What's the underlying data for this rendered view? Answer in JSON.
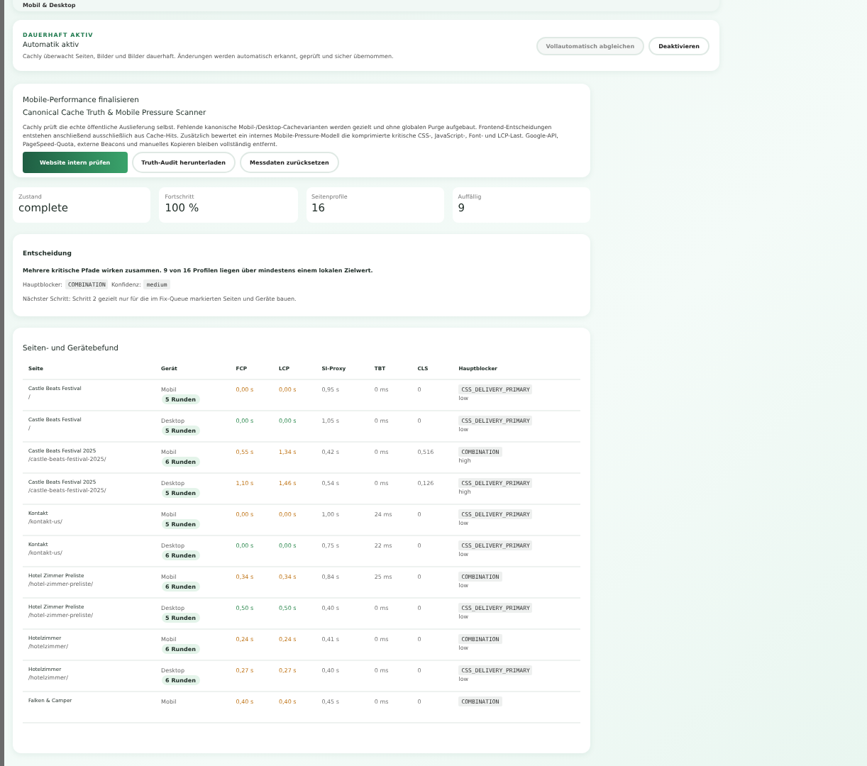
{
  "top_card": {
    "text": "Mobil & Desktop"
  },
  "automation": {
    "eyebrow": "DAUERHAFT AKTIV",
    "title": "Automatik aktiv",
    "description": "Cachly überwacht Seiten, Bilder und Bilder dauerhaft. Änderungen werden automatisch erkannt, geprüft und sicher übernommen.",
    "buttons": [
      {
        "label": "Vollautomatisch abgleichen",
        "disabled": true
      },
      {
        "label": "Deaktivieren",
        "disabled": false
      }
    ]
  },
  "mobile": {
    "heading": "Mobile-Performance finalisieren",
    "title": "Canonical Cache Truth & Mobile Pressure Scanner",
    "description": "Cachly prüft die echte öffentliche Auslieferung selbst. Fehlende kanonische Mobil-/Desktop-Cachevarianten werden gezielt und ohne globalen Purge aufgebaut. Frontend-Entscheidungen entstehen anschließend ausschließlich aus Cache-Hits. Zusätzlich bewertet ein internes Mobile-Pressure-Modell die komprimierte kritische CSS-, JavaScript-, Font- und LCP-Last. Google-API, PageSpeed-Quota, externe Beacons und manuelles Kopieren bleiben vollständig entfernt.",
    "buttons": [
      {
        "label": "Website intern prüfen",
        "kind": "primary"
      },
      {
        "label": "Truth-Audit herunterladen",
        "kind": "secondary"
      },
      {
        "label": "Messdaten zurücksetzen",
        "kind": "secondary"
      }
    ]
  },
  "stats": [
    {
      "label": "Zustand",
      "value": "complete"
    },
    {
      "label": "Fortschritt",
      "value": "100 %"
    },
    {
      "label": "Seitenprofile",
      "value": "16"
    },
    {
      "label": "Auffällig",
      "value": "9"
    }
  ],
  "decision": {
    "title": "Entscheidung",
    "summary": "Mehrere kritische Pfade wirken zusammen. 9 von 16 Profilen liegen über mindestens einem lokalen Zielwert.",
    "blocker_label": "Hauptblocker:",
    "blocker": "COMBINATION",
    "confidence_label": "Konfidenz:",
    "confidence": "medium",
    "next_step": "Nächster Schritt: Schritt 2 gezielt nur für die im Fix-Queue markierten Seiten und Geräte bauen."
  },
  "table": {
    "title": "Seiten- und Gerätebefund",
    "columns": [
      "Seite",
      "Gerät",
      "FCP",
      "LCP",
      "SI-Proxy",
      "TBT",
      "CLS",
      "Hauptblocker"
    ],
    "rows": [
      {
        "page": "Castle Beats Festival",
        "path": "/",
        "device": "Mobil",
        "rounds": "5 Runden",
        "fcp": {
          "text": "0,00 s",
          "slow": true
        },
        "lcp": {
          "text": "0,00 s",
          "slow": true
        },
        "si": "0,95 s",
        "tbt": "0 ms",
        "cls": "0",
        "blocker": "CSS_DELIVERY_PRIMARY",
        "impact": "low"
      },
      {
        "page": "Castle Beats Festival",
        "path": "/",
        "device": "Desktop",
        "rounds": "5 Runden",
        "fcp": {
          "text": "0,00 s",
          "slow": false
        },
        "lcp": {
          "text": "0,00 s",
          "slow": false
        },
        "si": "1,05 s",
        "tbt": "0 ms",
        "cls": "0",
        "blocker": "CSS_DELIVERY_PRIMARY",
        "impact": "low"
      },
      {
        "page": "Castle Beats Festival 2025",
        "path": "/castle-beats-festival-2025/",
        "device": "Mobil",
        "rounds": "6 Runden",
        "fcp": {
          "text": "0,55 s",
          "slow": true
        },
        "lcp": {
          "text": "1,34 s",
          "slow": true
        },
        "si": "0,42 s",
        "tbt": "0 ms",
        "cls": "0,516",
        "blocker": "COMBINATION",
        "impact": "high"
      },
      {
        "page": "Castle Beats Festival 2025",
        "path": "/castle-beats-festival-2025/",
        "device": "Desktop",
        "rounds": "5 Runden",
        "fcp": {
          "text": "1,10 s",
          "slow": true
        },
        "lcp": {
          "text": "1,46 s",
          "slow": true
        },
        "si": "0,54 s",
        "tbt": "0 ms",
        "cls": "0,126",
        "blocker": "CSS_DELIVERY_PRIMARY",
        "impact": "high"
      },
      {
        "page": "Kontakt",
        "path": "/kontakt-us/",
        "device": "Mobil",
        "rounds": "5 Runden",
        "fcp": {
          "text": "0,00 s",
          "slow": true
        },
        "lcp": {
          "text": "0,00 s",
          "slow": true
        },
        "si": "1,00 s",
        "tbt": "24 ms",
        "cls": "0",
        "blocker": "CSS_DELIVERY_PRIMARY",
        "impact": "low"
      },
      {
        "page": "Kontakt",
        "path": "/kontakt-us/",
        "device": "Desktop",
        "rounds": "6 Runden",
        "fcp": {
          "text": "0,00 s",
          "slow": false
        },
        "lcp": {
          "text": "0,00 s",
          "slow": false
        },
        "si": "0,75 s",
        "tbt": "22 ms",
        "cls": "0",
        "blocker": "CSS_DELIVERY_PRIMARY",
        "impact": "low"
      },
      {
        "page": "Hotel Zimmer Preliste",
        "path": "/hotel-zimmer-preliste/",
        "device": "Mobil",
        "rounds": "6 Runden",
        "fcp": {
          "text": "0,34 s",
          "slow": true
        },
        "lcp": {
          "text": "0,34 s",
          "slow": true
        },
        "si": "0,84 s",
        "tbt": "25 ms",
        "cls": "0",
        "blocker": "COMBINATION",
        "impact": "low"
      },
      {
        "page": "Hotel Zimmer Preliste",
        "path": "/hotel-zimmer-preliste/",
        "device": "Desktop",
        "rounds": "5 Runden",
        "fcp": {
          "text": "0,50 s",
          "slow": false
        },
        "lcp": {
          "text": "0,50 s",
          "slow": false
        },
        "si": "0,40 s",
        "tbt": "0 ms",
        "cls": "0",
        "blocker": "CSS_DELIVERY_PRIMARY",
        "impact": "low"
      },
      {
        "page": "Hotelzimmer",
        "path": "/hotelzimmer/",
        "device": "Mobil",
        "rounds": "6 Runden",
        "fcp": {
          "text": "0,24 s",
          "slow": true
        },
        "lcp": {
          "text": "0,24 s",
          "slow": true
        },
        "si": "0,41 s",
        "tbt": "0 ms",
        "cls": "0",
        "blocker": "COMBINATION",
        "impact": "low"
      },
      {
        "page": "Hotelzimmer",
        "path": "/hotelzimmer/",
        "device": "Desktop",
        "rounds": "6 Runden",
        "fcp": {
          "text": "0,27 s",
          "slow": true
        },
        "lcp": {
          "text": "0,27 s",
          "slow": true
        },
        "si": "0,40 s",
        "tbt": "0 ms",
        "cls": "0",
        "blocker": "CSS_DELIVERY_PRIMARY",
        "impact": "low"
      },
      {
        "page": "Falken & Camper",
        "device": "Mobil",
        "fcp": {
          "text": "0,40 s",
          "slow": true
        },
        "lcp": {
          "text": "0,40 s",
          "slow": true
        },
        "si": "0,45 s",
        "tbt": "0 ms",
        "cls": "0",
        "blocker": "COMBINATION"
      }
    ]
  }
}
